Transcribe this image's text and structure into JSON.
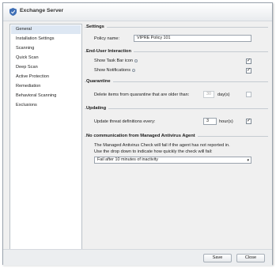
{
  "window": {
    "title": "Exchange Server"
  },
  "sidebar": {
    "items": [
      {
        "label": "General"
      },
      {
        "label": "Installation Settings"
      },
      {
        "label": "Scanning"
      },
      {
        "label": "Quick Scan"
      },
      {
        "label": "Deep Scan"
      },
      {
        "label": "Active Protection"
      },
      {
        "label": "Remediation"
      },
      {
        "label": "Behavioral Scanning"
      },
      {
        "label": "Exclusions"
      }
    ],
    "selected": "General"
  },
  "settings": {
    "title": "Settings",
    "policy_label": "Policy name:",
    "policy_value": "VIPRE Policy 101"
  },
  "end_user": {
    "title": "End-User Interaction",
    "taskbar_label": "Show Task Bar icon",
    "taskbar_checked": true,
    "notifications_label": "Show Notifications",
    "notifications_checked": true,
    "check_mark": "✓"
  },
  "quarantine": {
    "title": "Quarantine",
    "delete_label": "Delete items from quarantine that are older than:",
    "days_value": "30",
    "days_unit": "day(s)",
    "enabled": false
  },
  "updating": {
    "title": "Updating",
    "update_label": "Update threat definitions every:",
    "hours_value": "3",
    "hours_unit": "hour(s)",
    "enabled": true
  },
  "no_comm": {
    "title": "No communication from Managed Antivirus Agent",
    "line1": "The Managed Antivirus Check will fail if the agent has not reported in.",
    "line2": "Use the drop down to indicate how quickly the check will fail:",
    "selected_option": "Fail after 10 minutes of inactivity"
  },
  "footer": {
    "save_label": "Save",
    "close_label": "Close"
  }
}
